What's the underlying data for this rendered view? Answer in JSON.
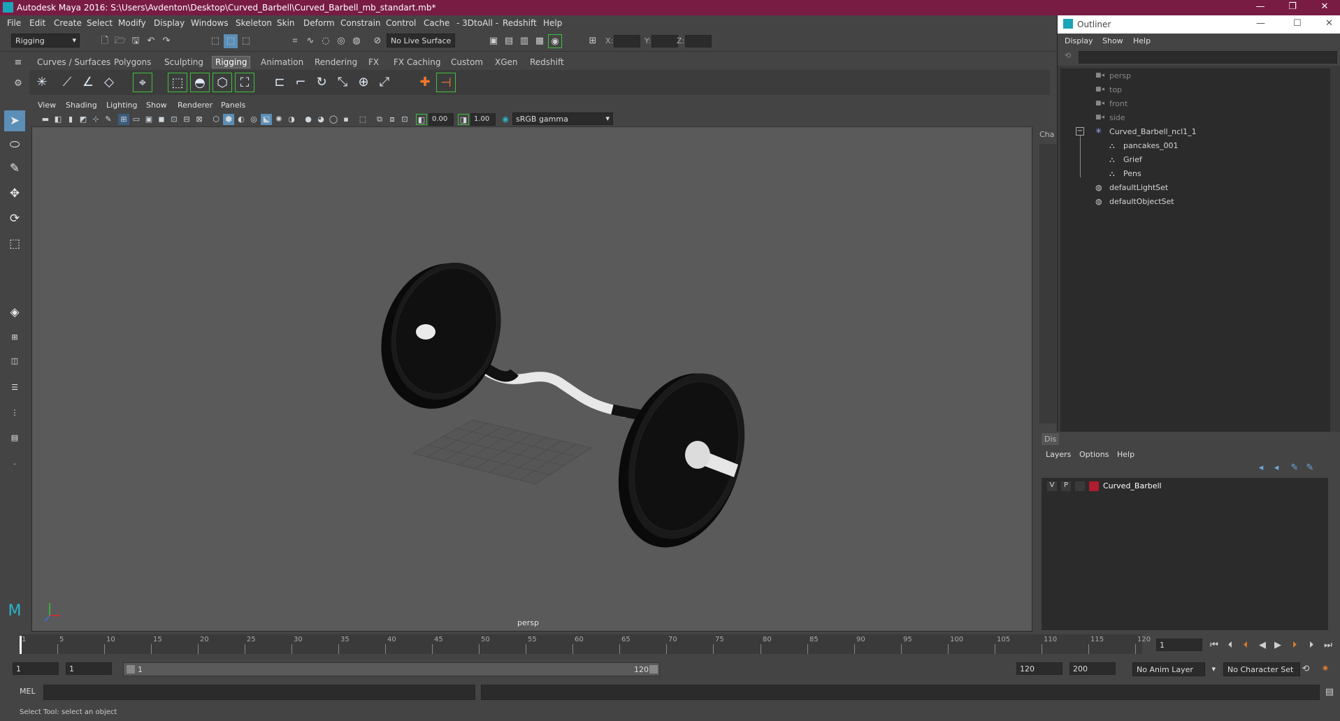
{
  "window": {
    "title": "Autodesk Maya 2016: S:\\Users\\Avdenton\\Desktop\\Curved_Barbell\\Curved_Barbell_mb_standart.mb*",
    "controls": [
      "—",
      "❐",
      "✕"
    ]
  },
  "menubar": [
    "File",
    "Edit",
    "Create",
    "Select",
    "Modify",
    "Display",
    "Windows",
    "Skeleton",
    "Skin",
    "Deform",
    "Constrain",
    "Control",
    "Cache",
    "- 3DtoAll -",
    "Redshift",
    "Help"
  ],
  "statusline": {
    "mode": "Rigging",
    "live_surface": "No Live Surface",
    "x_label": "X:",
    "y_label": "Y:",
    "z_label": "Z:"
  },
  "shelf": {
    "tabs": [
      "Curves / Surfaces",
      "Polygons",
      "Sculpting",
      "Rigging",
      "Animation",
      "Rendering",
      "FX",
      "FX Caching",
      "Custom",
      "XGen",
      "Redshift"
    ],
    "active_tab": "Rigging"
  },
  "viewport": {
    "menu": [
      "View",
      "Shading",
      "Lighting",
      "Show",
      "Renderer",
      "Panels"
    ],
    "exposure": "0.00",
    "gamma": "1.00",
    "colorspace": "sRGB gamma",
    "camera_label": "persp"
  },
  "outliner": {
    "title": "Outliner",
    "menu": [
      "Display",
      "Show",
      "Help"
    ],
    "items": [
      {
        "label": "persp",
        "dim": true
      },
      {
        "label": "top",
        "dim": true
      },
      {
        "label": "front",
        "dim": true
      },
      {
        "label": "side",
        "dim": true
      },
      {
        "label": "Curved_Barbell_ncl1_1",
        "dim": false
      },
      {
        "label": "pancakes_001",
        "dim": false
      },
      {
        "label": "Grief",
        "dim": false
      },
      {
        "label": "Pens",
        "dim": false
      },
      {
        "label": "defaultLightSet",
        "dim": false
      },
      {
        "label": "defaultObjectSet",
        "dim": false
      }
    ]
  },
  "side_tabs": {
    "channel": "Cha",
    "display": "Dis"
  },
  "layers": {
    "menu": [
      "Layers",
      "Options",
      "Help"
    ],
    "rows": [
      {
        "v": "V",
        "p": "P",
        "name": "Curved_Barbell",
        "color": "#b01c30"
      }
    ]
  },
  "timeline": {
    "ticks": [
      "1",
      "5",
      "10",
      "15",
      "20",
      "25",
      "30",
      "35",
      "40",
      "45",
      "50",
      "55",
      "60",
      "65",
      "70",
      "75",
      "80",
      "85",
      "90",
      "95",
      "100",
      "105",
      "110",
      "115",
      "120"
    ],
    "current_frame": "1"
  },
  "range": {
    "start": "1",
    "anim_start": "1",
    "slider_start": "1",
    "slider_end": "120",
    "anim_end": "120",
    "end": "200",
    "anim_layer": "No Anim Layer",
    "char_set": "No Character Set"
  },
  "cmdline": {
    "lang": "MEL"
  },
  "helpline": {
    "text": "Select Tool: select an object"
  },
  "colors": {
    "titlebar": "#781c44",
    "accent_green": "#3ec23e",
    "layer_red": "#b01c30"
  }
}
